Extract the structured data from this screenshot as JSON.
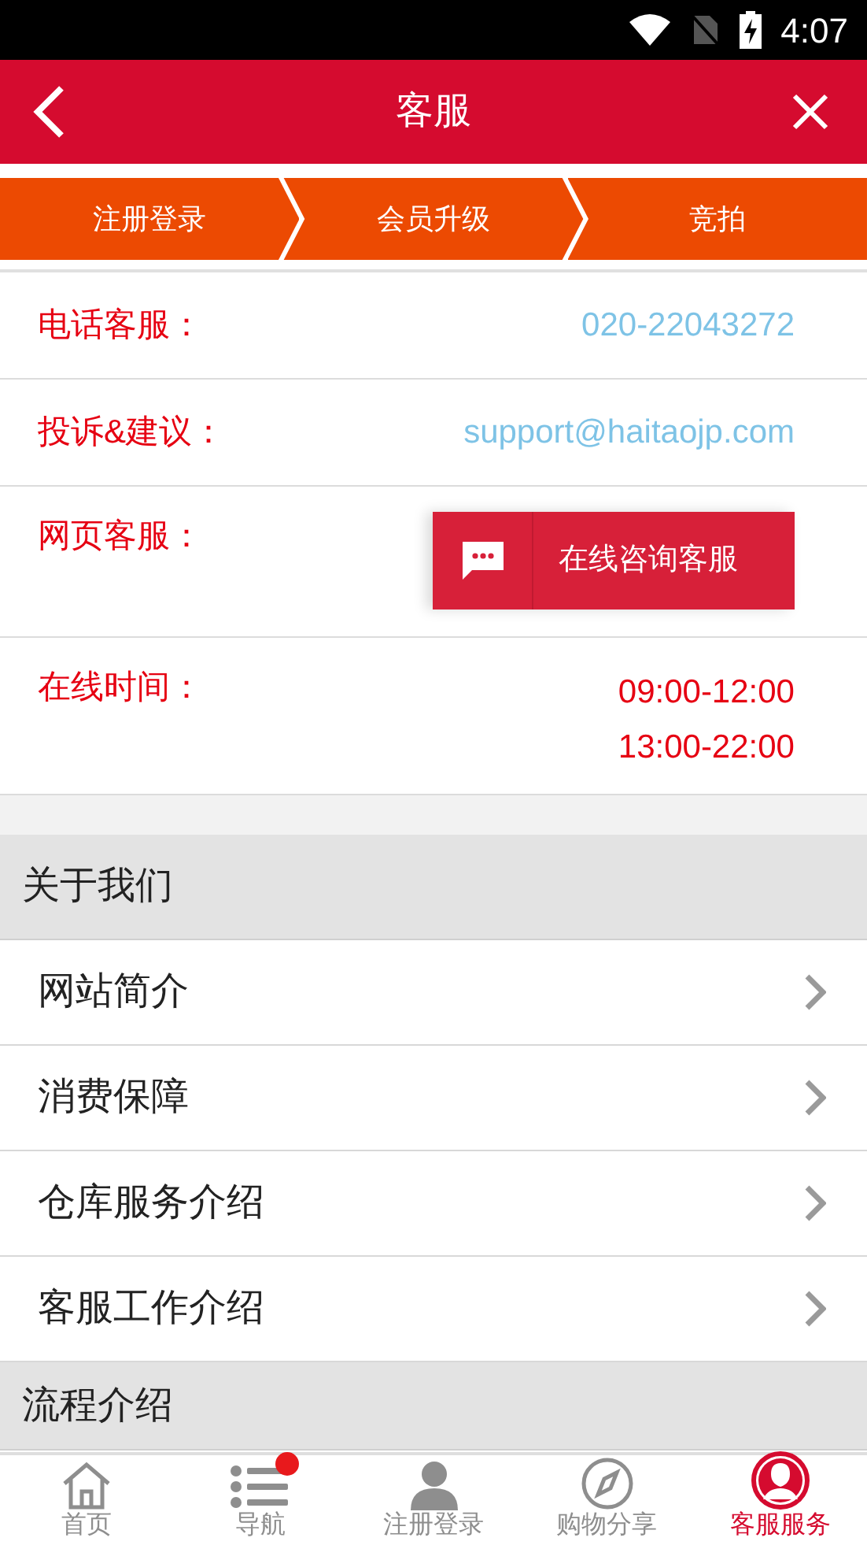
{
  "status_bar": {
    "time": "4:07"
  },
  "header": {
    "title": "客服"
  },
  "steps": [
    {
      "label": "注册登录"
    },
    {
      "label": "会员升级"
    },
    {
      "label": "竞拍"
    }
  ],
  "contacts": [
    {
      "kind": "text",
      "label": "电话客服：",
      "value": "020-22043272"
    },
    {
      "kind": "text",
      "label": "投诉&建议：",
      "value": "support@haitaojp.com"
    },
    {
      "kind": "button",
      "label": "网页客服：",
      "value": "在线咨询客服"
    },
    {
      "kind": "times",
      "label": "在线时间：",
      "lines": [
        "09:00-12:00",
        "13:00-22:00"
      ]
    }
  ],
  "sections": [
    {
      "title": "关于我们",
      "items": [
        "网站简介",
        "消费保障",
        "仓库服务介绍",
        "客服工作介绍"
      ]
    },
    {
      "title": "流程介绍"
    }
  ],
  "nav": [
    {
      "label": "首页",
      "kind": "home",
      "selected": false,
      "badge": false
    },
    {
      "label": "导航",
      "kind": "list",
      "selected": false,
      "badge": true
    },
    {
      "label": "注册登录",
      "kind": "person",
      "selected": false,
      "badge": false
    },
    {
      "label": "购物分享",
      "kind": "compass",
      "selected": false,
      "badge": false
    },
    {
      "label": "客服服务",
      "kind": "agent",
      "selected": true,
      "badge": false
    }
  ]
}
